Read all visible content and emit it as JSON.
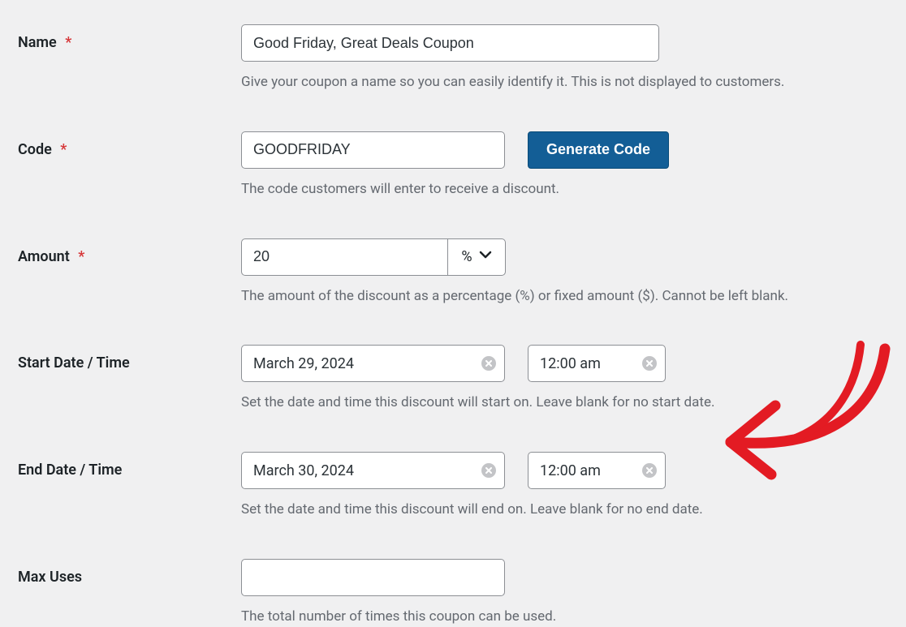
{
  "fields": {
    "name": {
      "label": "Name",
      "required_marker": "*",
      "value": "Good Friday, Great Deals Coupon",
      "help": "Give your coupon a name so you can easily identify it. This is not displayed to customers."
    },
    "code": {
      "label": "Code",
      "required_marker": "*",
      "value": "GOODFRIDAY",
      "generate_button": "Generate Code",
      "help": "The code customers will enter to receive a discount."
    },
    "amount": {
      "label": "Amount",
      "required_marker": "*",
      "value": "20",
      "unit": "%",
      "help": "The amount of the discount as a percentage (%) or fixed amount ($). Cannot be left blank."
    },
    "start": {
      "label": "Start Date / Time",
      "date": "March 29, 2024",
      "time": "12:00 am",
      "help": "Set the date and time this discount will start on. Leave blank for no start date."
    },
    "end": {
      "label": "End Date / Time",
      "date": "March 30, 2024",
      "time": "12:00 am",
      "help": "Set the date and time this discount will end on. Leave blank for no end date."
    },
    "max_uses": {
      "label": "Max Uses",
      "value": "",
      "help": "The total number of times this coupon can be used."
    }
  }
}
